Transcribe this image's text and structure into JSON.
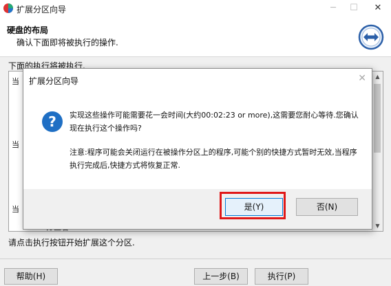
{
  "window": {
    "title": "扩展分区向导"
  },
  "header": {
    "title": "硬盘的布局",
    "subtitle": "确认下面即将被执行的操作."
  },
  "main": {
    "description": "下面的执行将被执行.",
    "partial_labels": [
      "当",
      "当",
      "当",
      "分区名"
    ],
    "footer_text": "请点击执行按钮开始扩展这个分区."
  },
  "buttons": {
    "help": "帮助(H)",
    "back": "上一步(B)",
    "execute": "执行(P)"
  },
  "dialog": {
    "title": "扩展分区向导",
    "message1": "实现这些操作可能需要花一会时间(大约00:02:23 or more),这需要您耐心等待.您确认现在执行这个操作吗?",
    "message2": "注意:程序可能会关闭运行在被操作分区上的程序,可能个别的快捷方式暂时无效,当程序执行完成后,快捷方式将恢复正常.",
    "yes": "是(Y)",
    "no": "否(N)"
  },
  "colors": {
    "accent": "#1f6fc4",
    "highlight": "#e01818"
  }
}
